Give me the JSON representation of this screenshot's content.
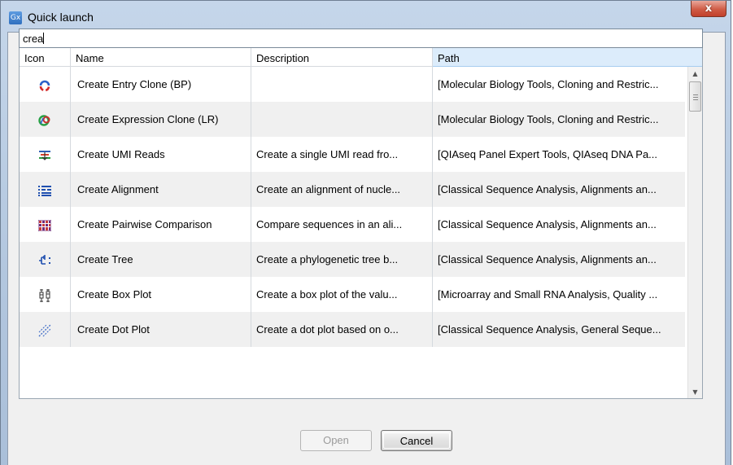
{
  "window": {
    "title": "Quick launch",
    "app_icon_text": "Gx",
    "close_label": "x"
  },
  "search": {
    "value": "crea"
  },
  "table": {
    "headers": [
      "Icon",
      "Name",
      "Description",
      "Path"
    ],
    "rows": [
      {
        "icon": "cloning-bp-icon",
        "name": "Create Entry Clone (BP)",
        "description": "",
        "path": "[Molecular Biology Tools, Cloning and Restric..."
      },
      {
        "icon": "cloning-lr-icon",
        "name": "Create Expression Clone (LR)",
        "description": "",
        "path": "[Molecular Biology Tools, Cloning and Restric..."
      },
      {
        "icon": "umi-reads-icon",
        "name": "Create UMI Reads",
        "description": "Create a single UMI read fro...",
        "path": "[QIAseq Panel Expert Tools, QIAseq DNA Pa..."
      },
      {
        "icon": "alignment-icon",
        "name": "Create Alignment",
        "description": "Create an alignment of nucle...",
        "path": "[Classical Sequence Analysis, Alignments an..."
      },
      {
        "icon": "pairwise-comparison-icon",
        "name": "Create Pairwise Comparison",
        "description": "Compare sequences in an ali...",
        "path": "[Classical Sequence Analysis, Alignments an..."
      },
      {
        "icon": "tree-icon",
        "name": "Create Tree",
        "description": "Create a phylogenetic tree b...",
        "path": "[Classical Sequence Analysis, Alignments an..."
      },
      {
        "icon": "box-plot-icon",
        "name": "Create Box Plot",
        "description": "Create a box plot of the valu...",
        "path": "[Microarray and Small RNA Analysis, Quality ..."
      },
      {
        "icon": "dot-plot-icon",
        "name": "Create Dot Plot",
        "description": "Create a dot plot based on o...",
        "path": "[Classical Sequence Analysis, General Seque..."
      }
    ]
  },
  "buttons": {
    "open_label": "Open",
    "cancel_label": "Cancel"
  },
  "colors": {
    "selected_header": "#dcecfb",
    "row_alt": "#f0f0f0",
    "close_button": "#c74a35"
  }
}
